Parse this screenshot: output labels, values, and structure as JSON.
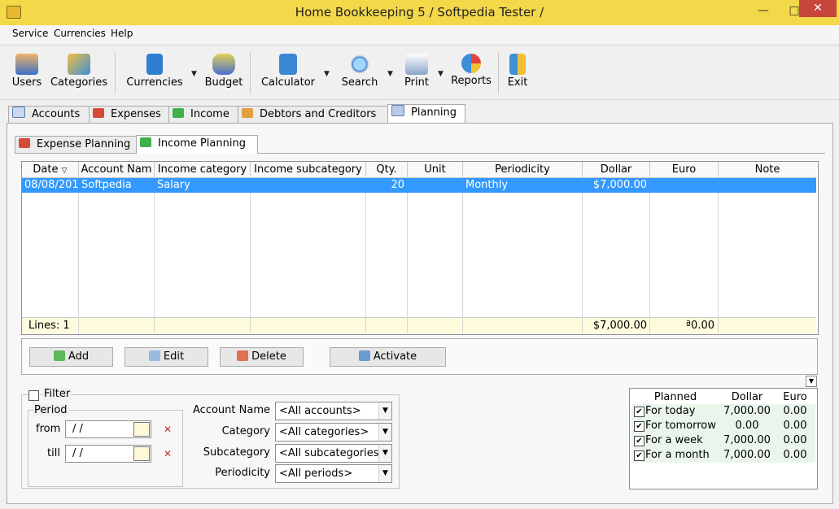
{
  "window": {
    "title": "Home Bookkeeping 5  / Softpedia Tester /",
    "minimize_glyph": "—",
    "maximize_glyph": "□",
    "close_glyph": "✕"
  },
  "menu": [
    "Service",
    "Currencies",
    "Help"
  ],
  "toolbar": {
    "users": "Users",
    "categories": "Categories",
    "currencies": "Currencies",
    "budget": "Budget",
    "calculator": "Calculator",
    "search": "Search",
    "print": "Print",
    "reports": "Reports",
    "exit": "Exit",
    "dropdown_glyph": "▼",
    "icon_names": [
      "users-icon",
      "categories-icon",
      "currencies-icon",
      "budget-icon",
      "calculator-icon",
      "search-icon",
      "print-icon",
      "reports-icon",
      "exit-icon"
    ]
  },
  "main_tabs": [
    {
      "label": "Accounts",
      "icon": "list-icon"
    },
    {
      "label": "Expenses",
      "icon": "coins-icon"
    },
    {
      "label": "Income",
      "icon": "income-icon"
    },
    {
      "label": "Debtors and Creditors",
      "icon": "debtors-icon"
    },
    {
      "label": "Planning",
      "icon": "planning-icon"
    }
  ],
  "active_main_tab": "Planning",
  "sub_tabs": [
    {
      "label": "Expense Planning",
      "icon": "expense-planning-icon"
    },
    {
      "label": "Income Planning",
      "icon": "income-planning-icon"
    }
  ],
  "active_sub_tab": "Income Planning",
  "grid": {
    "columns": [
      "Date",
      "Account Nam",
      "Income category",
      "Income subcategory",
      "Qty.",
      "Unit",
      "Periodicity",
      "Dollar",
      "Euro",
      "Note"
    ],
    "sort_glyph": "▽",
    "rows": [
      {
        "date": "08/08/201",
        "account": "Softpedia",
        "category": "Salary",
        "subcategory": "",
        "qty": "20",
        "unit": "",
        "periodicity": "Monthly",
        "dollar": "$7,000.00",
        "euro": "",
        "note": ""
      }
    ],
    "footer": {
      "lines": "Lines: 1",
      "dollar_total": "$7,000.00",
      "euro_total": "ª0.00"
    }
  },
  "buttons": {
    "add": "Add",
    "edit": "Edit",
    "delete": "Delete",
    "activate": "Activate"
  },
  "filter": {
    "label": "Filter",
    "checked": false,
    "period_label": "Period",
    "from_label": "from",
    "till_label": "till",
    "from_value": " /  /",
    "till_value": " /  /",
    "account_label": "Account Name",
    "account_value": "<All accounts>",
    "category_label": "Category",
    "category_value": "<All categories>",
    "subcategory_label": "Subcategory",
    "subcategory_value": "<All subcategories>",
    "periodicity_label": "Periodicity",
    "periodicity_value": "<All periods>",
    "combo_arrow_glyph": "▼"
  },
  "planned": {
    "toggle_glyph": "▼",
    "headers": [
      "Planned",
      "Dollar",
      "Euro"
    ],
    "check_glyph": "✔",
    "rows": [
      {
        "label": "For today",
        "dollar": "7,000.00",
        "euro": "0.00",
        "checked": true
      },
      {
        "label": "For tomorrow",
        "dollar": "0.00",
        "euro": "0.00",
        "checked": true
      },
      {
        "label": "For a week",
        "dollar": "7,000.00",
        "euro": "0.00",
        "checked": true
      },
      {
        "label": "For a month",
        "dollar": "7,000.00",
        "euro": "0.00",
        "checked": true
      }
    ]
  },
  "colors": {
    "titlebar": "#f3d84a",
    "selection": "#3399ff",
    "footer_row": "#fdfbdc",
    "planned_row": "#eaf6ec",
    "close_button": "#c7463c"
  }
}
